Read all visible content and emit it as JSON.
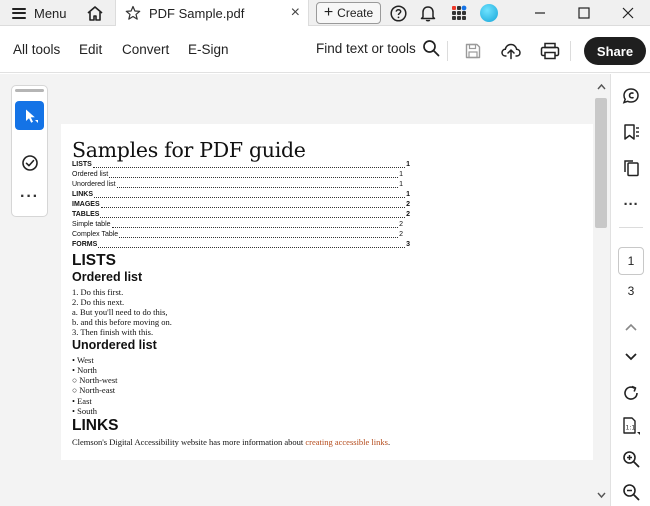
{
  "titlebar": {
    "menu_label": "Menu",
    "tab_title": "PDF Sample.pdf",
    "tab_close": "×",
    "create_label": "Create",
    "create_plus": "+",
    "min_glyph": "—",
    "max_glyph": "☐",
    "close_glyph": "✕"
  },
  "toolbar": {
    "all_tools": "All tools",
    "edit": "Edit",
    "convert": "Convert",
    "esign": "E-Sign",
    "find": "Find text or tools",
    "share": "Share"
  },
  "left_panel": {
    "more": "···"
  },
  "document": {
    "title": "Samples for PDF guide",
    "toc": [
      {
        "label": "LISTS",
        "page": "1"
      },
      {
        "label": "Ordered list",
        "page": "1"
      },
      {
        "label": "Unordered list",
        "page": "1"
      },
      {
        "label": "LINKS",
        "page": "1"
      },
      {
        "label": "IMAGES",
        "page": "2"
      },
      {
        "label": "TABLES",
        "page": "2"
      },
      {
        "label": "Simple table",
        "page": "2"
      },
      {
        "label": "Complex Table",
        "page": "2"
      },
      {
        "label": "FORMS",
        "page": "3"
      }
    ],
    "lists_heading": "LISTS",
    "ordered_heading": "Ordered list",
    "ordered_items": [
      "1. Do this first.",
      "2. Do this next.",
      "a. But you'll need to do this,",
      "b. and this before moving on.",
      "3. Then finish with this."
    ],
    "unordered_heading": "Unordered list",
    "unordered_items": [
      "• West",
      "• North",
      "○ North-west",
      "○ North-east",
      "• East",
      "• South"
    ],
    "links_heading": "LINKS",
    "links_text": "Clemson's Digital Accessibility website has more information about ",
    "links_link": "creating accessible links",
    "links_end": "."
  },
  "right_rail": {
    "current_page": "1",
    "total_pages": "3"
  },
  "colors": {
    "accent": "#1473e6",
    "share_bg": "#1f1f1f",
    "link": "#b44a1a"
  },
  "icons": [
    "hamburger-icon",
    "home-icon",
    "star-icon",
    "help-icon",
    "bell-icon",
    "apps-icon",
    "search-icon",
    "save-icon",
    "upload-icon",
    "print-icon",
    "select-arrow-icon",
    "checkmark-icon",
    "comment-icon",
    "bookmark-icon",
    "copy-pages-icon",
    "more-icon",
    "chevron-up-icon",
    "chevron-down-icon",
    "rotate-icon",
    "fit-page-icon",
    "zoom-in-icon",
    "zoom-out-icon"
  ]
}
